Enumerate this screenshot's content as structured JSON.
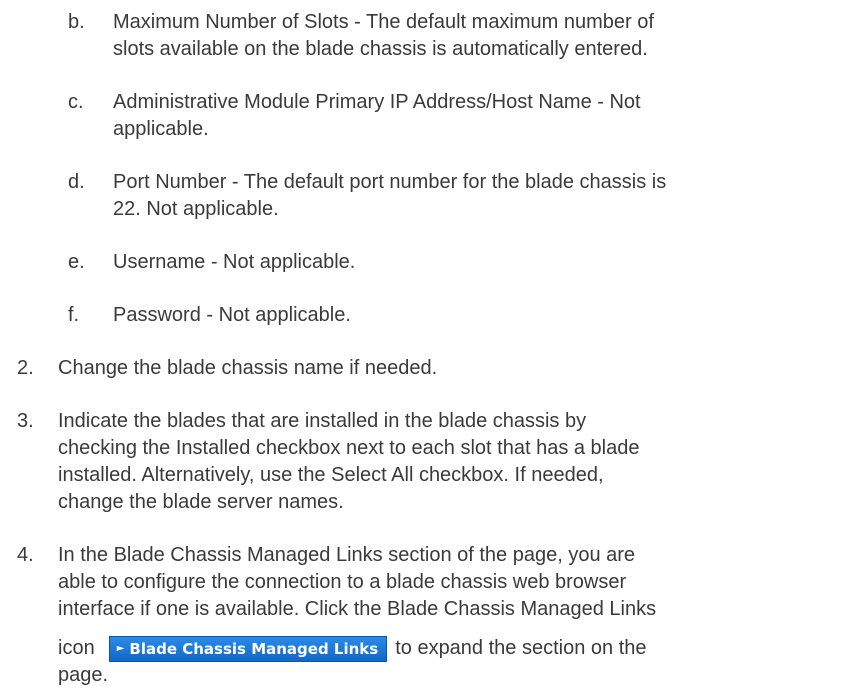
{
  "substeps": [
    {
      "marker": "b.",
      "lines": [
        "Maximum Number of Slots - The default maximum number of",
        "slots available on the blade chassis is automatically entered."
      ]
    },
    {
      "marker": "c.",
      "lines": [
        "Administrative Module Primary IP Address/Host Name - Not",
        "applicable."
      ]
    },
    {
      "marker": "d.",
      "lines": [
        "Port Number - The default port number for the blade chassis is",
        "22. Not applicable."
      ]
    },
    {
      "marker": "e.",
      "lines": [
        "Username - Not applicable."
      ]
    },
    {
      "marker": "f.",
      "lines": [
        "Password - Not applicable."
      ]
    }
  ],
  "steps": [
    {
      "marker": "2.",
      "lines": [
        "Change the blade chassis name if needed."
      ]
    },
    {
      "marker": "3.",
      "lines": [
        "Indicate the blades that are installed in the blade chassis by",
        "checking the Installed checkbox next to each slot that has a blade",
        "installed. Alternatively, use the Select All checkbox. If needed,",
        "change the blade server names."
      ]
    },
    {
      "marker": "4.",
      "lines": [
        "In the Blade Chassis Managed Links section of the page, you are",
        "able to configure the connection to a blade chassis web browser",
        "interface if one is available. Click the Blade Chassis Managed Links"
      ],
      "icon_line_before": "icon",
      "icon_line_after": "to expand the section on the",
      "last_line": "page."
    }
  ],
  "inline_button": {
    "icon": "expand-triangle-icon",
    "label": "Blade Chassis Managed Links",
    "color": "#1a73d6"
  }
}
